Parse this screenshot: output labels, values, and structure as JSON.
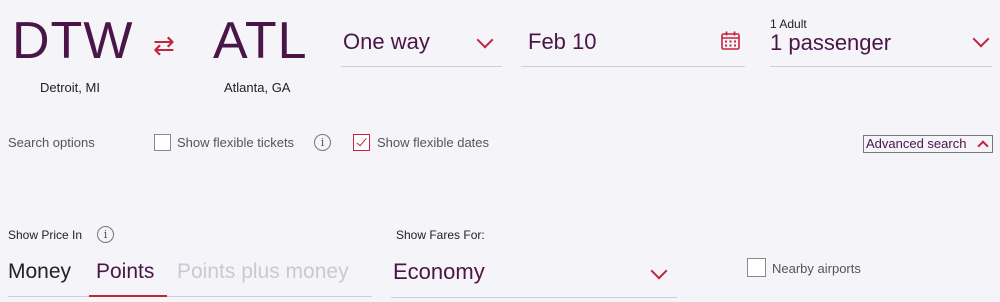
{
  "route": {
    "origin": {
      "code": "DTW",
      "city": "Detroit, MI"
    },
    "destination": {
      "code": "ATL",
      "city": "Atlanta, GA"
    },
    "swap_glyph": "⇄"
  },
  "trip_type": {
    "value": "One way"
  },
  "date": {
    "value": "Feb 10"
  },
  "passengers": {
    "summary": "1 Adult",
    "value": "1 passenger"
  },
  "search_options": {
    "label": "Search options",
    "flexible_tickets": {
      "label": "Show flexible tickets",
      "checked": false
    },
    "flexible_dates": {
      "label": "Show flexible dates",
      "checked": true
    },
    "info_glyph": "i",
    "advanced_search": "Advanced search"
  },
  "price": {
    "label": "Show Price In",
    "info_glyph": "i",
    "options": [
      "Money",
      "Points",
      "Points plus money"
    ],
    "selected": "Points"
  },
  "fares": {
    "label": "Show Fares For:",
    "value": "Economy"
  },
  "nearby": {
    "label": "Nearby airports",
    "checked": false
  },
  "colors": {
    "accent": "#c5243d",
    "brand_text": "#4a1547",
    "background": "#f4f4f9"
  },
  "icons": [
    "swap-icon",
    "chevron-down-icon",
    "calendar-icon",
    "info-icon",
    "chevron-up-icon",
    "checkmark-icon"
  ]
}
